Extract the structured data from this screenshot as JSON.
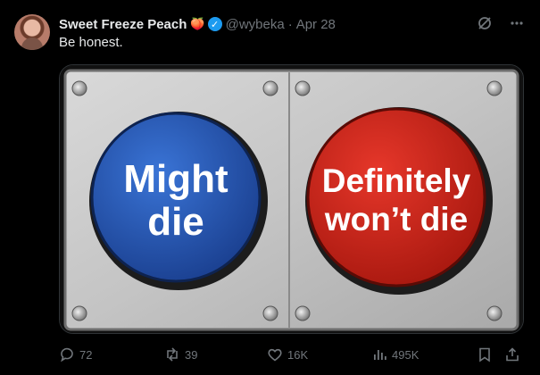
{
  "tweet": {
    "author_name": "Sweet Freeze Peach",
    "author_emoji": "🍑",
    "handle": "@wybeka",
    "separator": "·",
    "date": "Apr 28",
    "text": "Be honest."
  },
  "media": {
    "left_button_line1": "Might",
    "left_button_line2": "die",
    "right_button_line1": "Definitely",
    "right_button_line2": "won’t die",
    "left_button_color": "#1f52b0",
    "right_button_color": "#cc2418"
  },
  "actions": {
    "replies": "72",
    "reposts": "39",
    "likes": "16K",
    "views": "495K"
  },
  "icons": {
    "header": [
      "grok-icon",
      "more-icon"
    ],
    "actions": [
      "reply-icon",
      "repost-icon",
      "like-icon",
      "views-icon",
      "bookmark-icon",
      "share-icon"
    ]
  },
  "colors": {
    "verified": "#1d9bf0",
    "muted": "#71767b",
    "text": "#e7e9ea",
    "background": "#000000"
  }
}
